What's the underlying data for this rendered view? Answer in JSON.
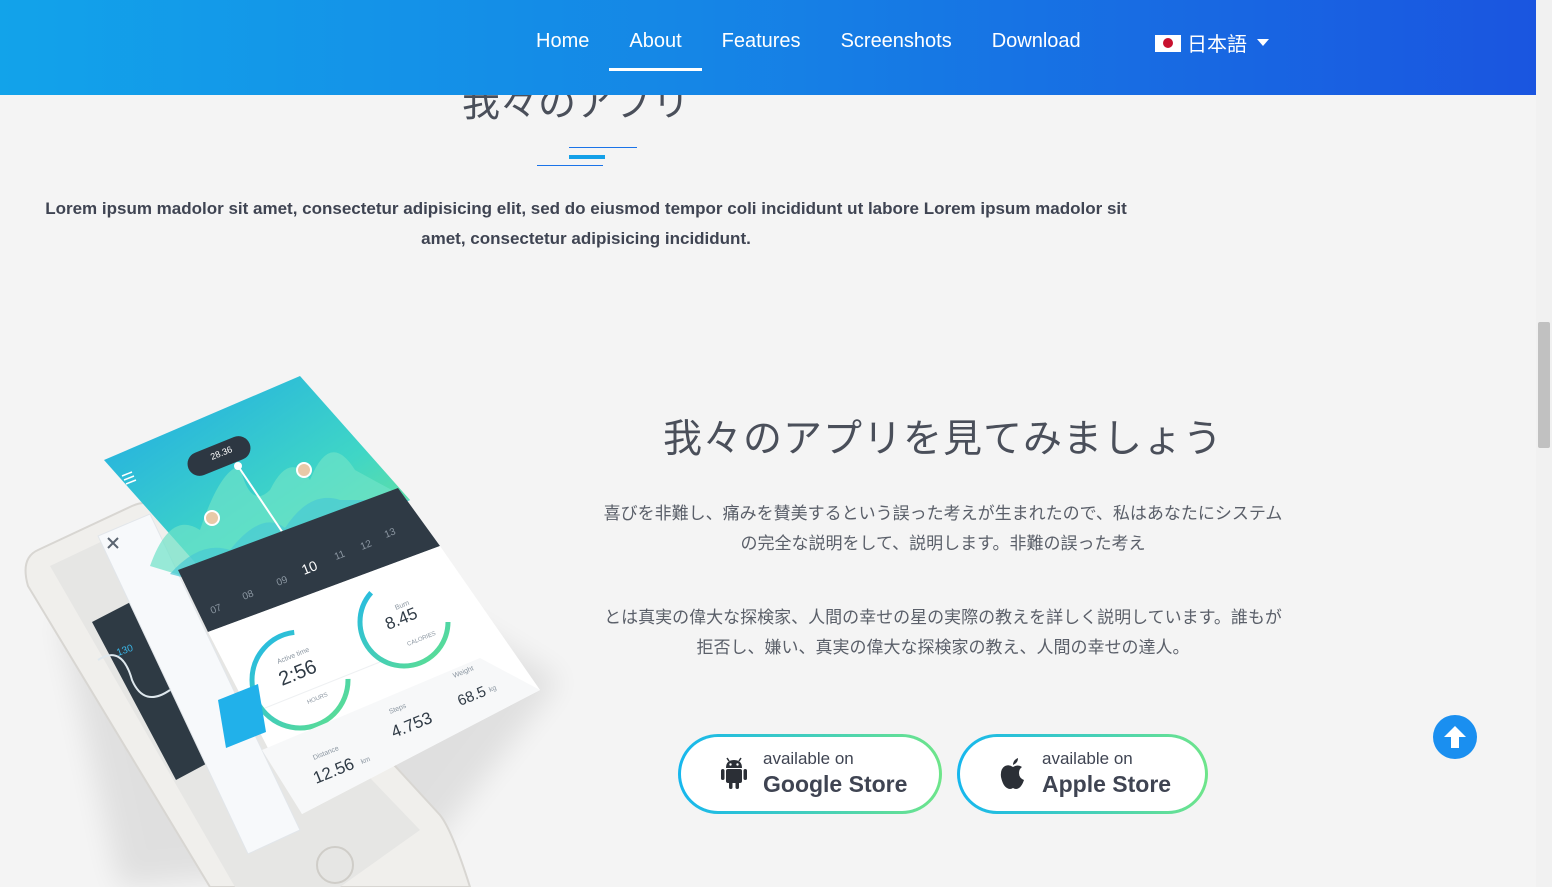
{
  "nav": {
    "items": [
      {
        "label": "Home",
        "active": false
      },
      {
        "label": "About",
        "active": true
      },
      {
        "label": "Features",
        "active": false
      },
      {
        "label": "Screenshots",
        "active": false
      },
      {
        "label": "Download",
        "active": false
      }
    ],
    "language": "日本語"
  },
  "section": {
    "title": "我々のアプリ",
    "description": "Lorem ipsum madolor sit amet, consectetur adipisicing elit, sed do eiusmod tempor coli incididunt ut labore Lorem ipsum madolor sit amet, consectetur adipisicing incididunt."
  },
  "app": {
    "heading": "我々のアプリを見てみましょう",
    "paragraph1": "喜びを非難し、痛みを賛美するという誤った考えが生まれたので、私はあなたにシステムの完全な説明をして、説明します。非難の誤った考え",
    "paragraph2": "とは真実の偉大な探検家、人間の幸せの星の実際の教えを詳しく説明しています。誰もが拒否し、嫌い、真実の偉大な探検家の教え、人間の幸せの達人。"
  },
  "phone_screen": {
    "top_reading": "28.36",
    "days": [
      "07",
      "08",
      "09",
      "10",
      "11",
      "12",
      "13"
    ],
    "active_time": "2:56",
    "active_time_label": "Active time",
    "active_time_unit": "HOURS",
    "burn": "8.45",
    "burn_label": "Burn",
    "burn_unit": "CALORIES",
    "distance": "12.56",
    "distance_label": "Distance",
    "distance_unit": "km",
    "steps": "4.753",
    "steps_label": "Steps",
    "weight": "68.5",
    "weight_label": "Weight",
    "weight_unit": "kg",
    "back_heart": "130"
  },
  "stores": {
    "google": {
      "small": "available on",
      "big": "Google Store"
    },
    "apple": {
      "small": "available on",
      "big": "Apple Store"
    }
  },
  "colors": {
    "nav_start": "#12a3ea",
    "nav_end": "#1a55e0",
    "accent": "#14a0e8",
    "button_gradient_start": "#16b7ee",
    "button_gradient_end": "#6ee58a",
    "back_to_top": "#1a8ff0"
  },
  "icons": [
    "android-icon",
    "apple-icon",
    "arrow-up-icon",
    "japan-flag-icon",
    "caret-down-icon"
  ]
}
